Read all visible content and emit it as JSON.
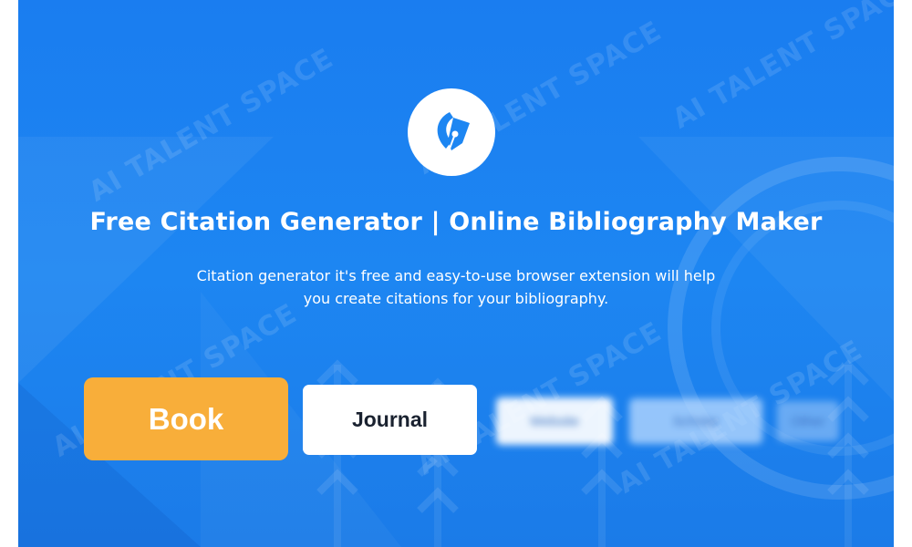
{
  "hero": {
    "title": "Free Citation Generator | Online Bibliography Maker",
    "subtitle": "Citation generator it's free and easy-to-use browser extension will help you create citations for your bibliography."
  },
  "source_types": [
    {
      "label": "Book",
      "color": "#f8ae3a"
    },
    {
      "label": "Journal",
      "color": "#ffffff"
    },
    {
      "label": "Website"
    },
    {
      "label": "Scholar"
    },
    {
      "label": "Other"
    }
  ],
  "watermark": "AI TALENT SPACE",
  "colors": {
    "background": "#1d86f2",
    "accent": "#f8ae3a",
    "button_text": "#1a2230"
  },
  "icons": {
    "logo": "pen-nib-icon"
  }
}
